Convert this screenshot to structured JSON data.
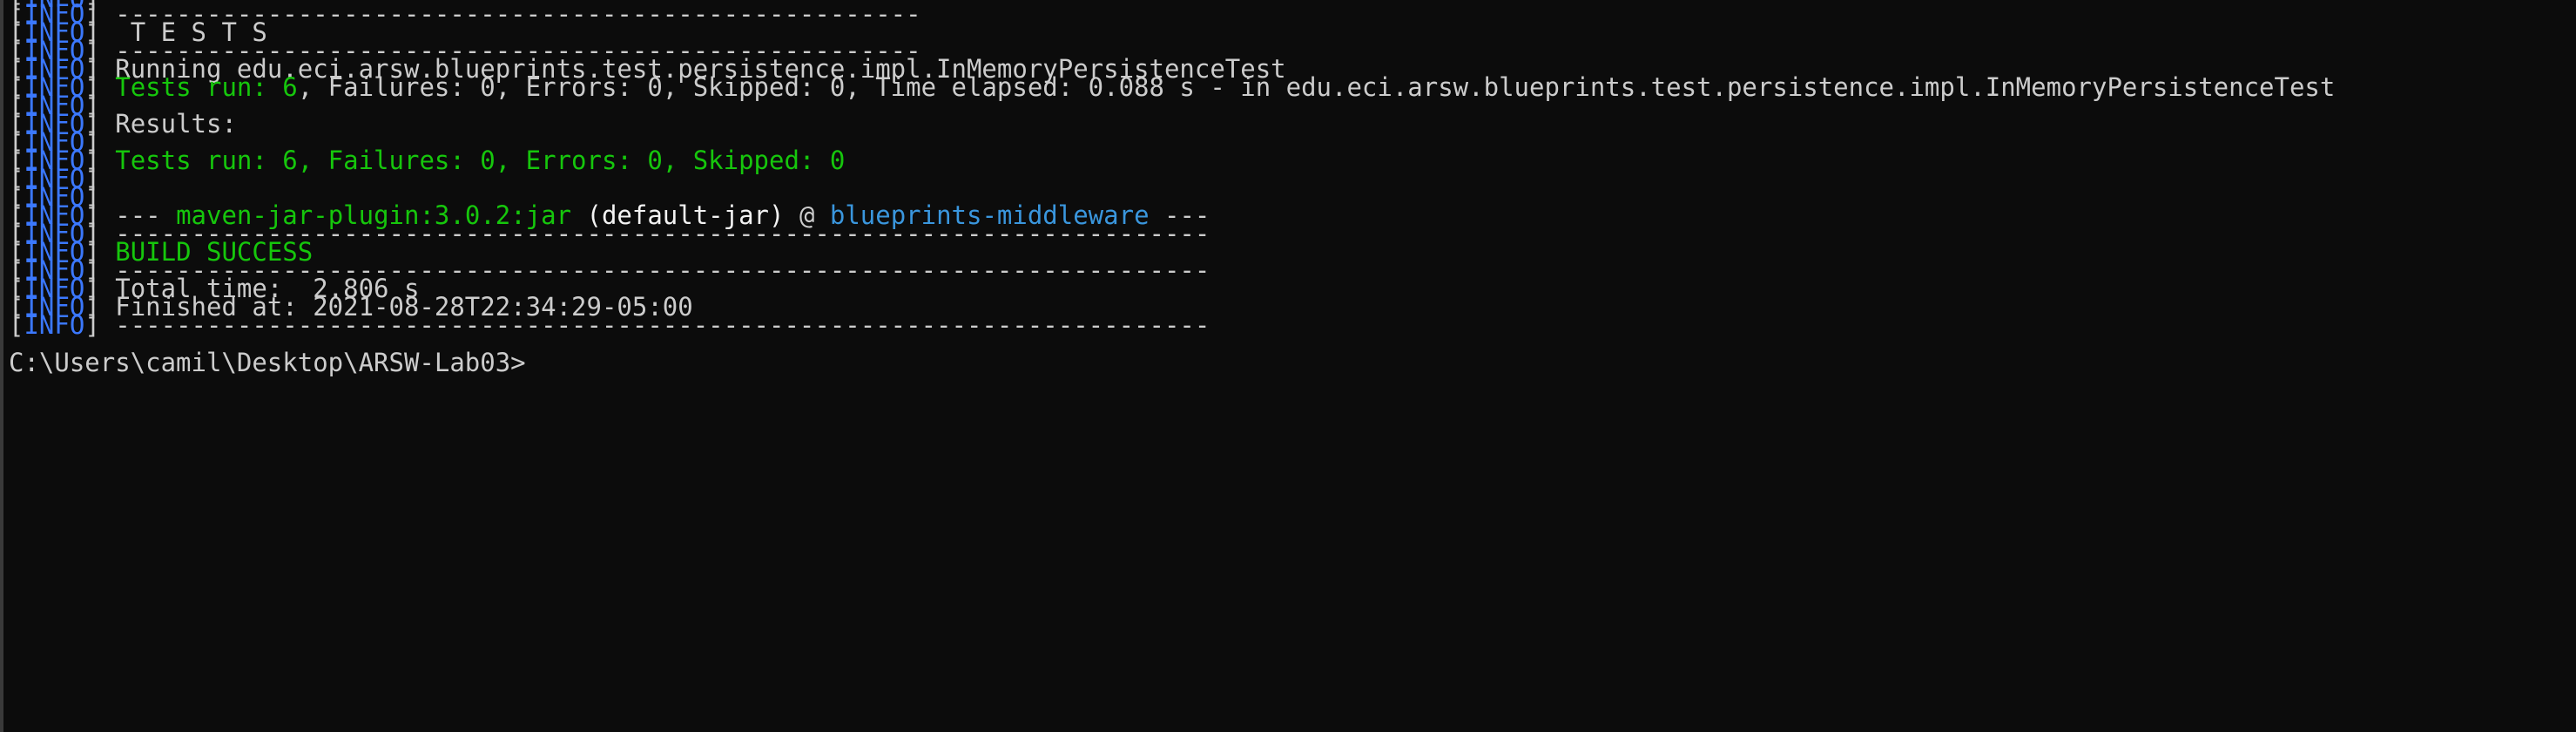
{
  "tag": "INFO",
  "lines": [
    {
      "text": " -----------------------------------------------------"
    },
    {
      "text": "  T E S T S"
    },
    {
      "text": " -----------------------------------------------------"
    },
    {
      "text": " Running edu.eci.arsw.blueprints.test.persistence.impl.InMemoryPersistenceTest"
    },
    {
      "green": "Tests run: 6",
      "rest": ", Failures: 0, Errors: 0, Skipped: 0, Time elapsed: 0.088 s - in edu.eci.arsw.blueprints.test.persistence.impl.InMemoryPersistenceTest"
    },
    {
      "text": ""
    },
    {
      "text": " Results:"
    },
    {
      "text": ""
    },
    {
      "green": "Tests run: 6, Failures: 0, Errors: 0, Skipped: 0"
    },
    {
      "text": ""
    },
    {
      "text": ""
    },
    {
      "prefix": " --- ",
      "plugin": "maven-jar-plugin:3.0.2:jar",
      "exec": " (default-jar)",
      "at": " @ ",
      "project": "blueprints-middleware",
      "suffix": " ---"
    },
    {
      "text": " ------------------------------------------------------------------------"
    },
    {
      "green": "BUILD SUCCESS"
    },
    {
      "text": " ------------------------------------------------------------------------"
    },
    {
      "text": " Total time:  2.806 s"
    },
    {
      "text": " Finished at: 2021-08-28T22:34:29-05:00"
    },
    {
      "text": " ------------------------------------------------------------------------"
    }
  ],
  "prompt": "C:\\Users\\camil\\Desktop\\ARSW-Lab03>"
}
